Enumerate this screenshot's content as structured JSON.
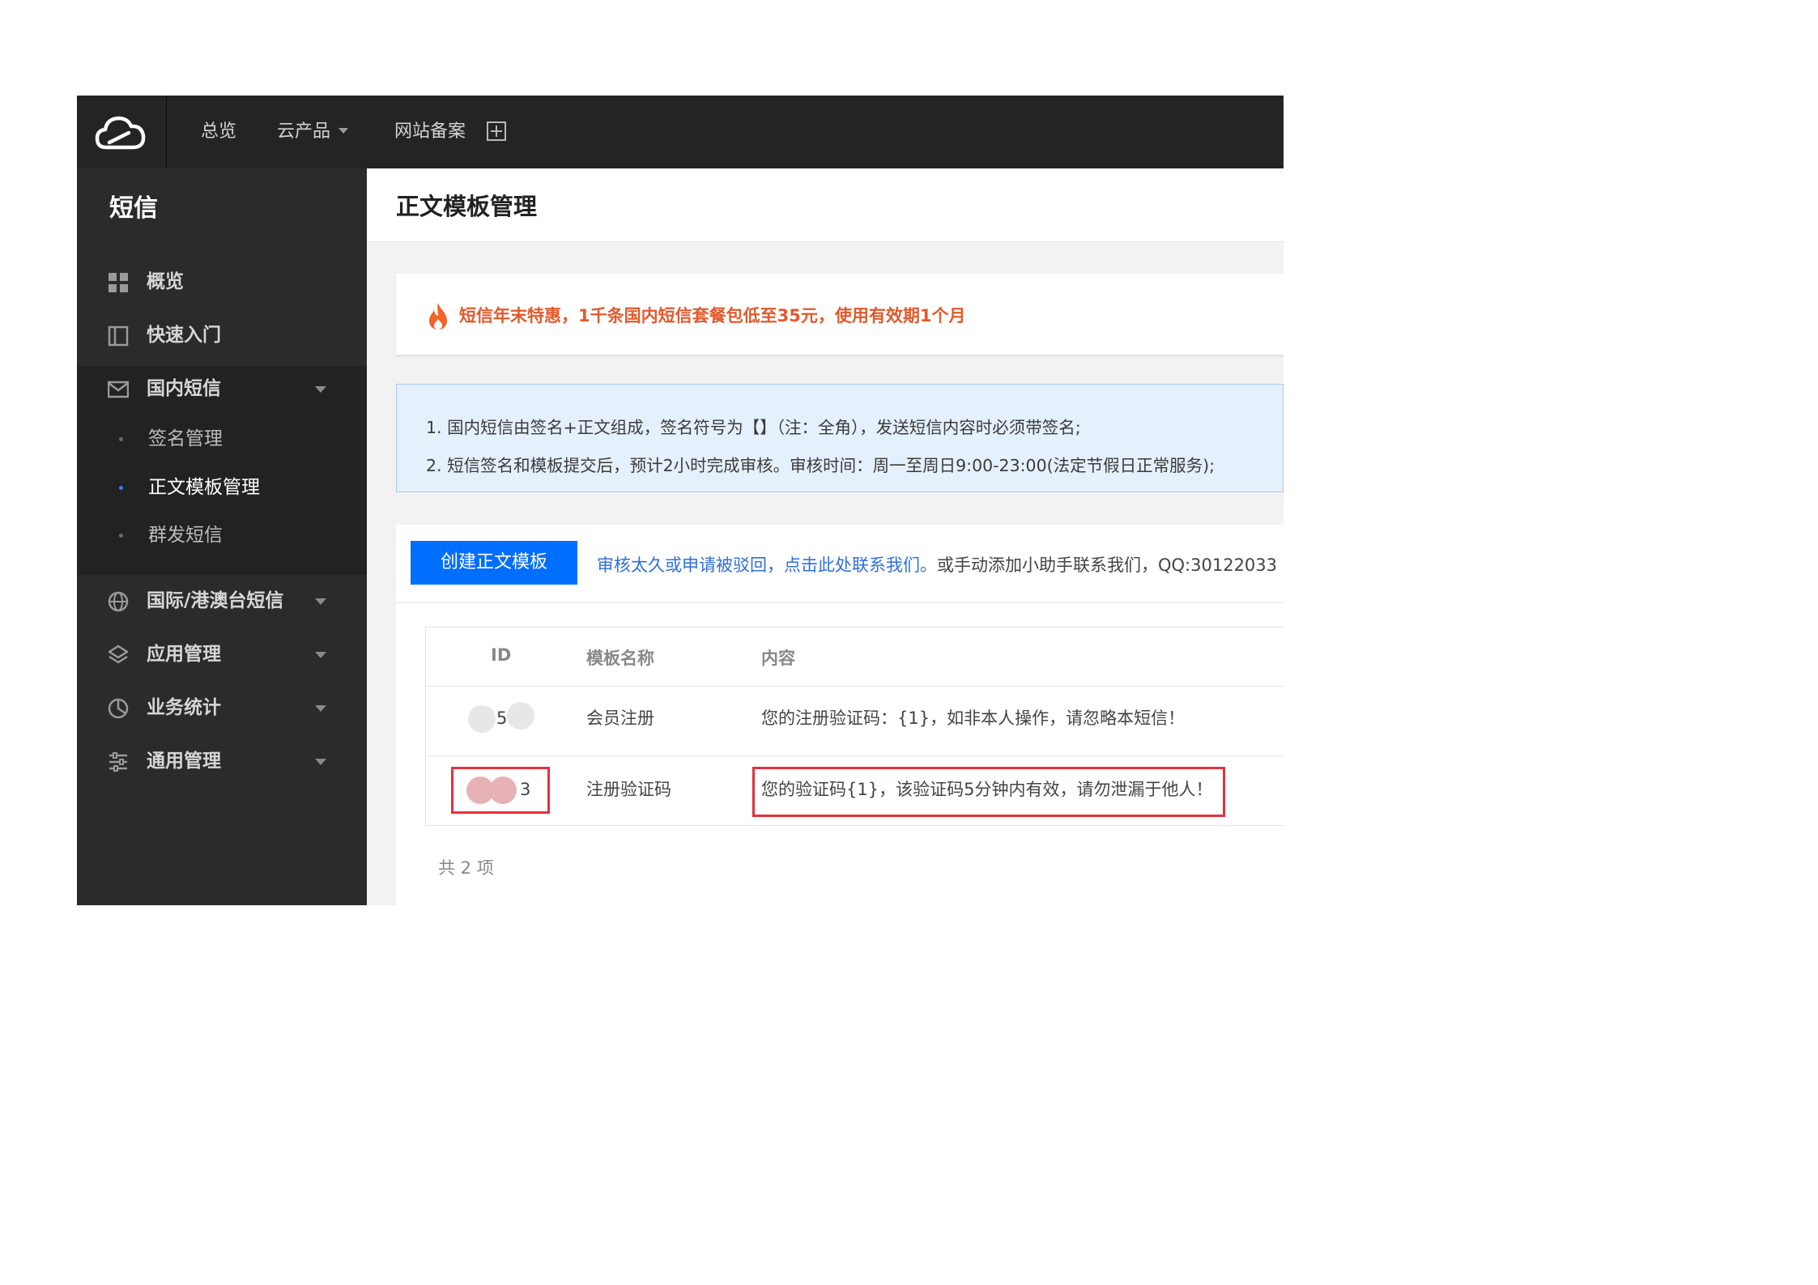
{
  "topbar": {
    "logo": "cloud-logo-icon",
    "nav": [
      {
        "label": "总览"
      },
      {
        "label": "云产品"
      },
      {
        "label": "网站备案"
      }
    ]
  },
  "sidebar": {
    "title": "短信",
    "items": [
      {
        "label": "概览",
        "icon": "grid-icon"
      },
      {
        "label": "快速入门",
        "icon": "book-icon"
      },
      {
        "label": "国内短信",
        "icon": "mail-icon",
        "expanded": true,
        "children": [
          {
            "label": "签名管理"
          },
          {
            "label": "正文模板管理",
            "active": true
          },
          {
            "label": "群发短信"
          }
        ]
      },
      {
        "label": "国际/港澳台短信",
        "icon": "globe-icon"
      },
      {
        "label": "应用管理",
        "icon": "layers-icon"
      },
      {
        "label": "业务统计",
        "icon": "pie-chart-icon"
      },
      {
        "label": "通用管理",
        "icon": "sliders-icon"
      }
    ]
  },
  "page": {
    "title": "正文模板管理",
    "promo": "短信年末特惠，1千条国内短信套餐包低至35元，使用有效期1个月",
    "tips": [
      "1. 国内短信由签名+正文组成，签名符号为【】（注：全角），发送短信内容时必须带签名;",
      "2. 短信签名和模板提交后，预计2小时完成审核。审核时间：周一至周日9:00-23:00(法定节假日正常服务);"
    ],
    "create_button": "创建正文模板",
    "hint_link": "审核太久或申请被驳回，点击此处联系我们。",
    "hint_rest": "或手动添加小助手联系我们，QQ:30122033",
    "table": {
      "columns": [
        "ID",
        "模板名称",
        "内容"
      ],
      "rows": [
        {
          "id_suffix": "5",
          "name": "会员注册",
          "content": "您的注册验证码：{1}，如非本人操作，请忽略本短信！"
        },
        {
          "id_suffix": "3",
          "name": "注册验证码",
          "content": "您的验证码{1}，该验证码5分钟内有效，请勿泄漏于他人！"
        }
      ]
    },
    "total": "共 2 项"
  },
  "colors": {
    "topbar": "#242424",
    "sidebar": "#2b2b2b",
    "primary_button": "#006eff",
    "promo_text": "#e15a2c",
    "highlight_box": "#e6303e",
    "link": "#2f6fdf"
  }
}
